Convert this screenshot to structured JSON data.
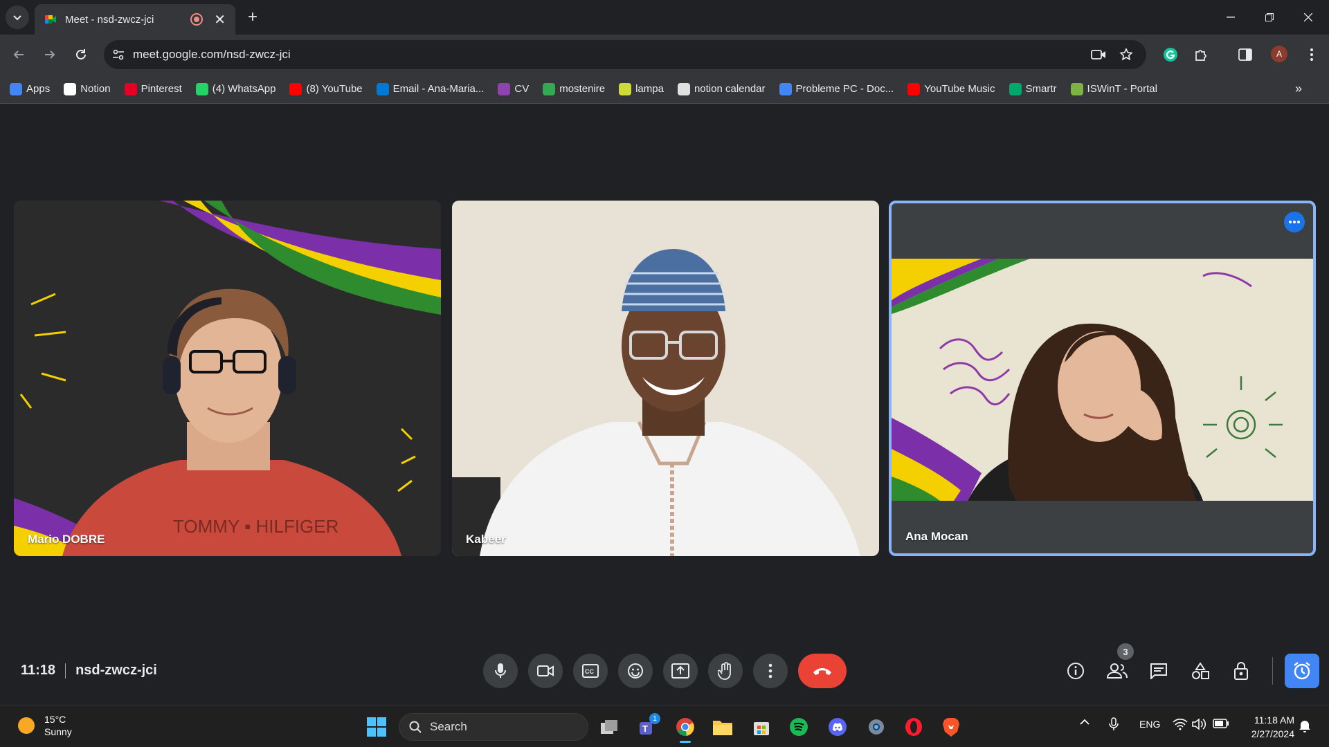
{
  "browser": {
    "tab_title": "Meet - nsd-zwcz-jci",
    "url": "meet.google.com/nsd-zwcz-jci",
    "profile_initial": "A"
  },
  "bookmarks": [
    {
      "label": "Apps",
      "icon": "apps-grid-icon",
      "color": "#4285f4"
    },
    {
      "label": "Notion",
      "icon": "notion-icon",
      "color": "#ffffff"
    },
    {
      "label": "Pinterest",
      "icon": "pinterest-icon",
      "color": "#e60023"
    },
    {
      "label": "(4) WhatsApp",
      "icon": "whatsapp-icon",
      "color": "#25d366"
    },
    {
      "label": "(8) YouTube",
      "icon": "youtube-icon",
      "color": "#ff0000"
    },
    {
      "label": "Email - Ana-Maria...",
      "icon": "outlook-icon",
      "color": "#0078d4"
    },
    {
      "label": "CV",
      "icon": "canva-icon",
      "color": "#8e44ad"
    },
    {
      "label": "mostenire",
      "icon": "google-drive-icon",
      "color": "#34a853"
    },
    {
      "label": "lampa",
      "icon": "lampa-icon",
      "color": "#cddc39"
    },
    {
      "label": "notion calendar",
      "icon": "calendar-icon",
      "color": "#e0e0e0"
    },
    {
      "label": "Probleme PC - Doc...",
      "icon": "google-docs-icon",
      "color": "#4285f4"
    },
    {
      "label": "YouTube Music",
      "icon": "youtube-music-icon",
      "color": "#ff0000"
    },
    {
      "label": "Smartr",
      "icon": "smartr-icon",
      "color": "#00a86b"
    },
    {
      "label": "ISWinT - Portal",
      "icon": "iswint-icon",
      "color": "#7cb342"
    }
  ],
  "participants": [
    {
      "name": "Mario DOBRE"
    },
    {
      "name": "Kabeer"
    },
    {
      "name": "Ana Mocan"
    }
  ],
  "meeting": {
    "time": "11:18",
    "code": "nsd-zwcz-jci",
    "people_count": "3"
  },
  "taskbar": {
    "weather_temp": "15°C",
    "weather_desc": "Sunny",
    "search_placeholder": "Search",
    "teams_badge": "1",
    "language": "ENG",
    "clock_time": "11:18 AM",
    "clock_date": "2/27/2024"
  },
  "colors": {
    "meet_bg": "#202124",
    "hangup": "#ea4335",
    "active_speaker": "#8ab4f8",
    "accent": "#1a73e8"
  }
}
